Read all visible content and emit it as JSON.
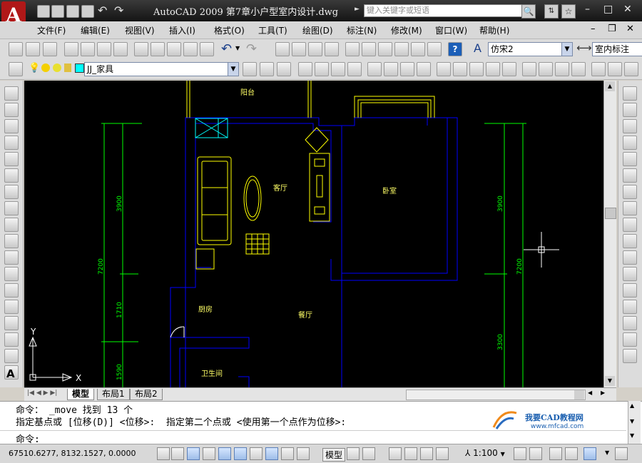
{
  "title_bar": {
    "title": "AutoCAD 2009  第7章小户型室内设计.dwg",
    "search_placeholder": "键入关键字或短语",
    "app_logo_letter": "A",
    "quick_access_icons": [
      "new-icon",
      "open-icon",
      "save-icon",
      "print-icon",
      "undo-icon",
      "redo-icon"
    ],
    "window_buttons": {
      "minimize": "–",
      "restore": "□",
      "close": "✕"
    }
  },
  "menu_bar": {
    "items": [
      "文件(F)",
      "编辑(E)",
      "视图(V)",
      "插入(I)",
      "格式(O)",
      "工具(T)",
      "绘图(D)",
      "标注(N)",
      "修改(M)",
      "窗口(W)",
      "帮助(H)"
    ],
    "doc_buttons": {
      "minimize": "–",
      "restore": "❐",
      "close": "✕"
    }
  },
  "standard_toolbar": {
    "text_style": "仿宋2",
    "dim_style": "室内标注"
  },
  "layers_toolbar": {
    "current_layer": "JJ_家具",
    "layer_color": "#00ffff"
  },
  "drawing": {
    "rooms": [
      "阳台",
      "客厅",
      "卧室",
      "厨房",
      "餐厅",
      "卫生间"
    ],
    "dims_left": [
      "3900",
      "7200",
      "1710",
      "1590"
    ],
    "dims_right": [
      "3900",
      "7200",
      "3300"
    ],
    "ucs": {
      "x": "X",
      "y": "Y"
    },
    "colors": {
      "wall": "#0000ff",
      "furniture": "#ffff00",
      "dim": "#00ff00",
      "cyan": "#00ffff",
      "text": "#ffff66",
      "background": "#000000"
    }
  },
  "layout_tabs": [
    "模型",
    "布局1",
    "布局2"
  ],
  "command": {
    "lines": [
      "命令： _move 找到 13 个",
      "指定基点或 [位移(D)] <位移>:  指定第二个点或 <使用第一个点作为位移>:"
    ],
    "prompt": "命令:",
    "watermark_title": "我要CAD教程网",
    "watermark_url": "www.mfcad.com"
  },
  "status_bar": {
    "coordinates": "67510.6277, 8132.1527, 0.0000",
    "model_label": "模型",
    "scale": "1:100"
  }
}
